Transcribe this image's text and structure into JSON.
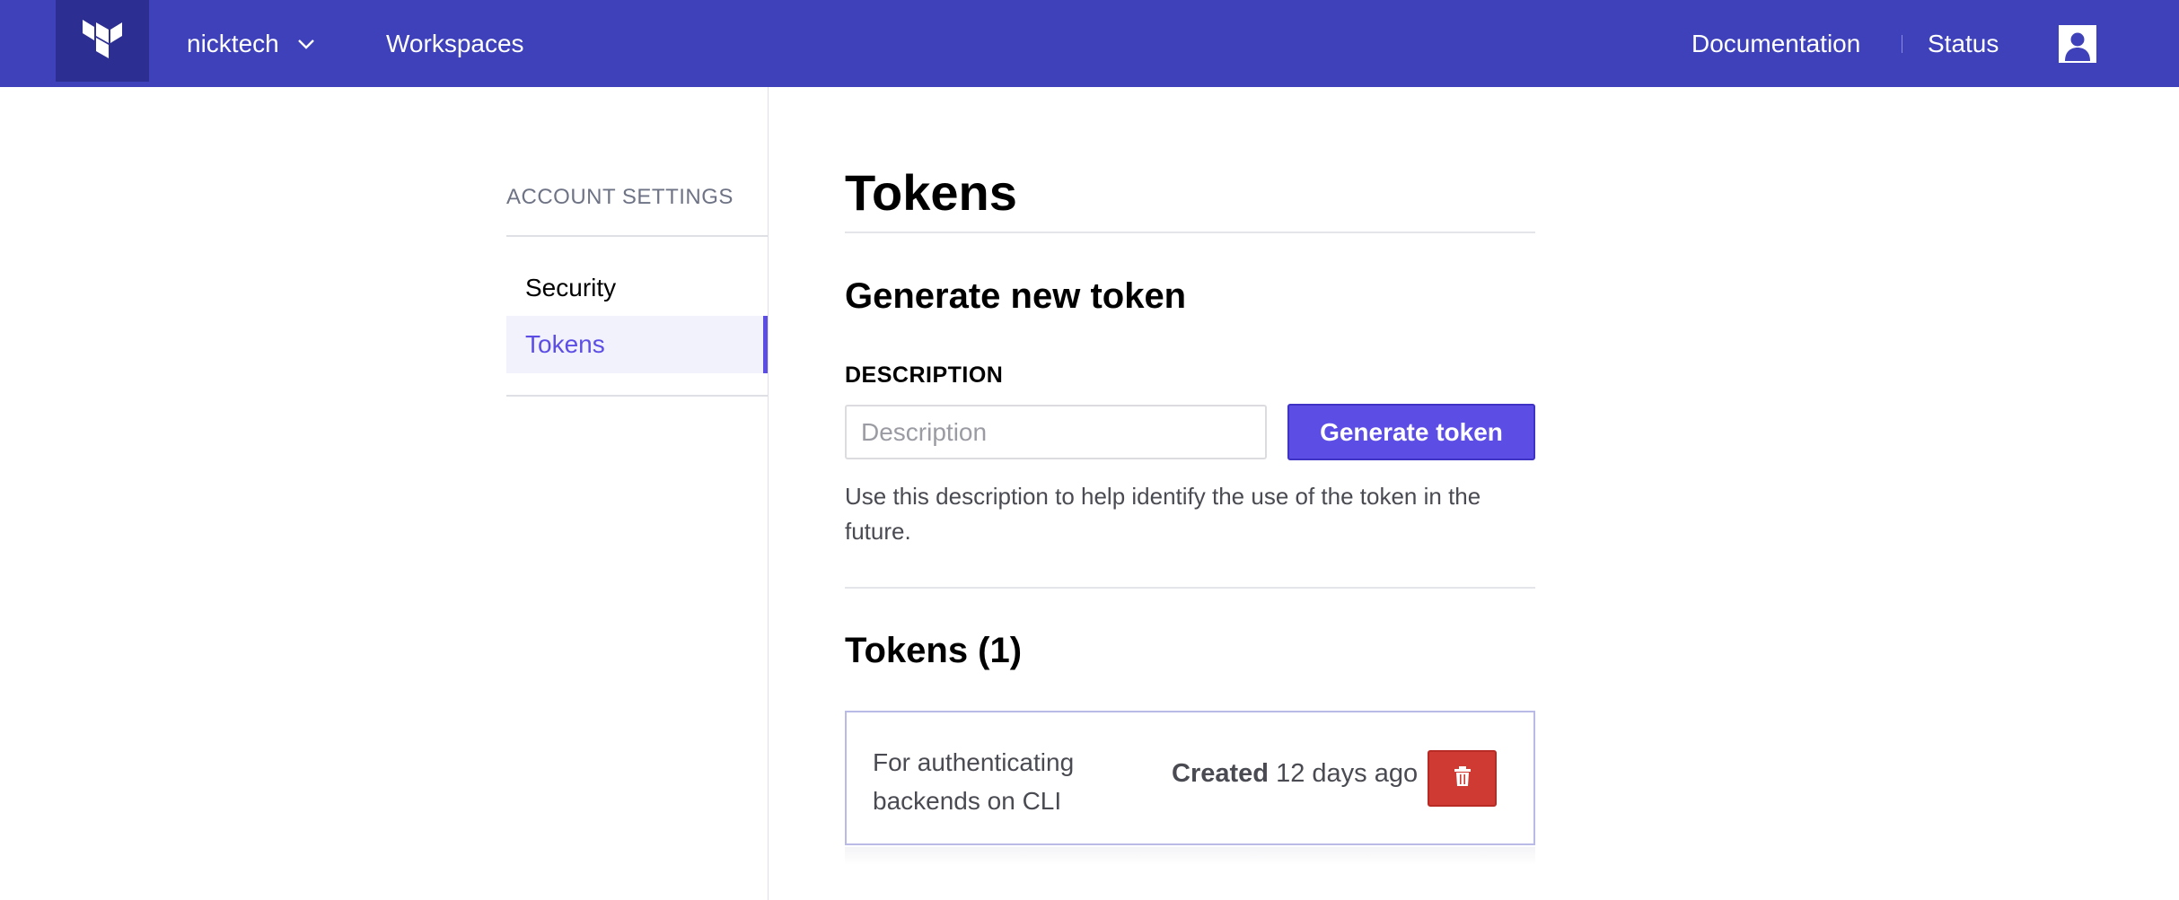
{
  "header": {
    "org_name": "nicktech",
    "nav_workspaces": "Workspaces",
    "nav_documentation": "Documentation",
    "nav_status": "Status",
    "icons": {
      "logo": "terraform-logo-icon",
      "org_dropdown": "chevron-down-icon",
      "user": "user-avatar-icon"
    },
    "colors": {
      "bar": "#3e41b9",
      "logo_bg": "#2c2e92"
    }
  },
  "sidebar": {
    "heading": "ACCOUNT SETTINGS",
    "items": [
      {
        "label": "Security",
        "active": false
      },
      {
        "label": "Tokens",
        "active": true
      }
    ],
    "accent_color": "#5c4ee5"
  },
  "main": {
    "title": "Tokens",
    "generate": {
      "heading": "Generate new token",
      "field_label": "DESCRIPTION",
      "input_value": "",
      "input_placeholder": "Description",
      "button_label": "Generate token",
      "help_text": "Use this description to help identify the use of the token in the future."
    },
    "token_list": {
      "heading": "Tokens (1)",
      "items": [
        {
          "description": "For authenticating backends on CLI",
          "created_label": "Created",
          "created_value": "12 days ago",
          "delete_icon": "trash-icon"
        }
      ]
    },
    "colors": {
      "primary_button": "#5c4ee5",
      "danger_button": "#cf3b33"
    }
  }
}
